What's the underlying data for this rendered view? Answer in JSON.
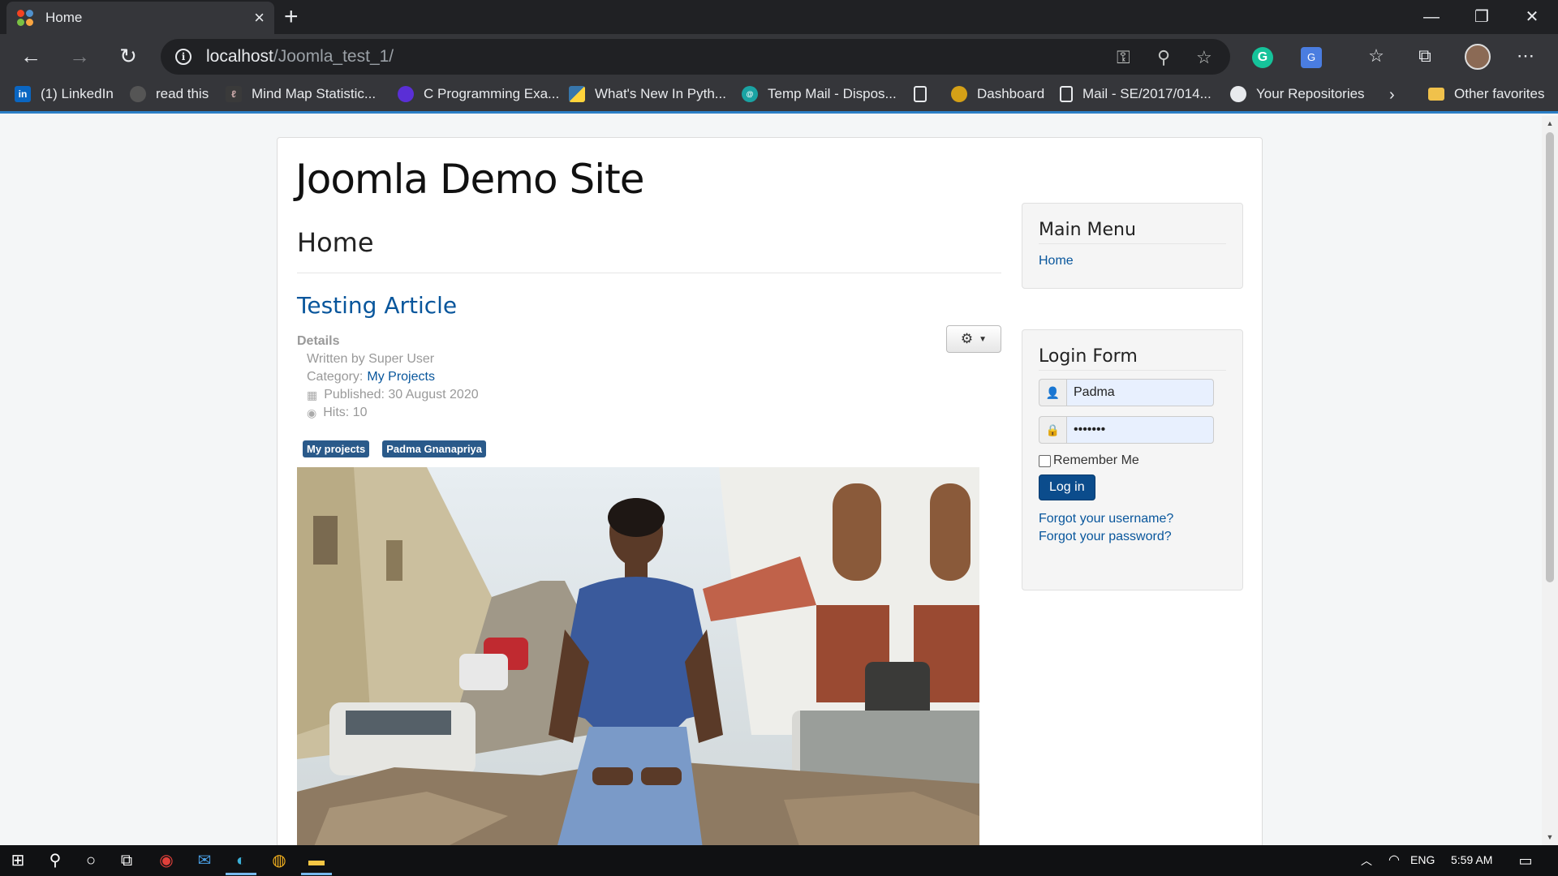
{
  "browser": {
    "tab_title": "Home",
    "new_tab": "+",
    "url_host": "localhost",
    "url_path": "/Joomla_test_1/",
    "window_controls": {
      "minimize": "—",
      "restore": "❐",
      "close": "✕"
    },
    "nav": {
      "back": "←",
      "forward": "→",
      "reload": "↻"
    }
  },
  "bookmarks": [
    {
      "label": "(1) LinkedIn",
      "icon": "linkedin-icon",
      "color": "#0a66c2"
    },
    {
      "label": "read this",
      "icon": "github-icon",
      "color": "#444"
    },
    {
      "label": "Mind Map  Statistic...",
      "icon": "mindmap-icon",
      "color": "#3a3a3a"
    },
    {
      "label": "C Programming Exa...",
      "icon": "programiz-icon",
      "color": "#5a2fd6"
    },
    {
      "label": "What's New In Pyth...",
      "icon": "python-icon",
      "color": "#3776ab"
    },
    {
      "label": "Temp Mail - Dispos...",
      "icon": "tempmail-icon",
      "color": "#1aa3a3"
    },
    {
      "label": "",
      "icon": "page-icon",
      "color": "transparent"
    },
    {
      "label": "Dashboard",
      "icon": "dashboard-icon",
      "color": "#d4a017"
    },
    {
      "label": "Mail - SE/2017/014...",
      "icon": "page-icon",
      "color": "transparent"
    },
    {
      "label": "Your Repositories",
      "icon": "github-icon",
      "color": "#444"
    }
  ],
  "other_favorites": "Other favorites",
  "site": {
    "title": "Joomla Demo Site",
    "page_heading": "Home",
    "article": {
      "title": "Testing Article",
      "details_label": "Details",
      "written_by": "Written by Super User",
      "category_label": "Category:",
      "category_link": "My Projects",
      "published": "Published: 30 August 2020",
      "hits": "Hits: 10",
      "tags": [
        "My projects",
        "Padma Gnanapriya"
      ]
    }
  },
  "main_menu": {
    "title": "Main Menu",
    "items": [
      "Home"
    ]
  },
  "login": {
    "title": "Login Form",
    "username_value": "Padma",
    "password_value": "•••••••",
    "remember_label": "Remember Me",
    "submit_label": "Log in",
    "forgot_username": "Forgot your username?",
    "forgot_password": "Forgot your password?"
  },
  "taskbar": {
    "language": "ENG",
    "time": "5:59 AM"
  }
}
